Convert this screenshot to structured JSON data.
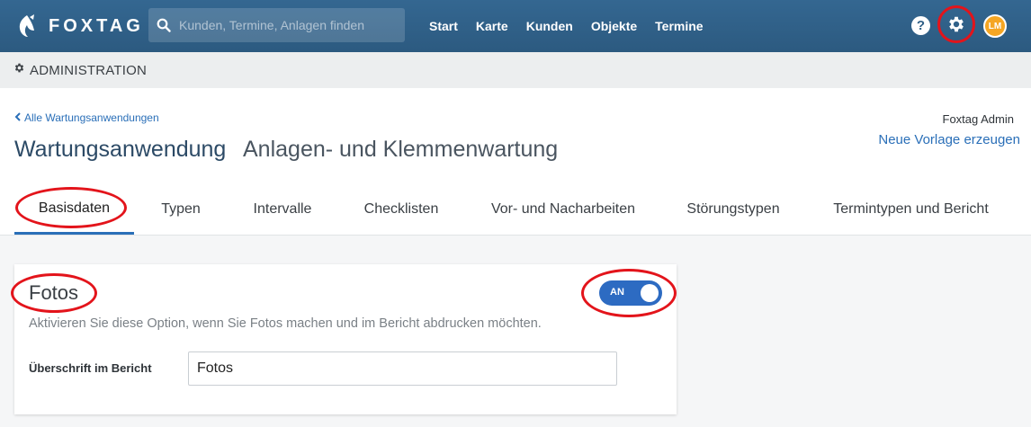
{
  "navbar": {
    "brand": "FOXTAG",
    "search_placeholder": "Kunden, Termine, Anlagen finden",
    "links": [
      "Start",
      "Karte",
      "Kunden",
      "Objekte",
      "Termine"
    ],
    "help_label": "?",
    "avatar_initials": "LM"
  },
  "adminbar": {
    "label": "ADMINISTRATION"
  },
  "header": {
    "back_link": "Alle Wartungsanwendungen",
    "title": "Wartungsanwendung",
    "subtitle": "Anlagen- und Klemmenwartung",
    "admin_name": "Foxtag Admin",
    "new_template": "Neue Vorlage erzeugen"
  },
  "tabs": [
    {
      "label": "Basisdaten",
      "active": true
    },
    {
      "label": "Typen"
    },
    {
      "label": "Intervalle"
    },
    {
      "label": "Checklisten"
    },
    {
      "label": "Vor- und Nacharbeiten"
    },
    {
      "label": "Störungstypen"
    },
    {
      "label": "Termintypen und Bericht"
    }
  ],
  "photos_card": {
    "title": "Fotos",
    "toggle_label": "AN",
    "description": "Aktivieren Sie diese Option, wenn Sie Fotos machen und im Bericht abdrucken möchten.",
    "field_label": "Überschrift im Bericht",
    "field_value": "Fotos"
  },
  "colors": {
    "navbar": "#2f5f86",
    "accent": "#2a6fb8",
    "toggle_on": "#2d6bc2",
    "avatar": "#f5a623",
    "annotation": "#e3141b"
  },
  "icons": [
    "fox-logo-icon",
    "search-icon",
    "help-icon",
    "gear-icon",
    "cog-small-icon",
    "chevron-left-icon"
  ]
}
